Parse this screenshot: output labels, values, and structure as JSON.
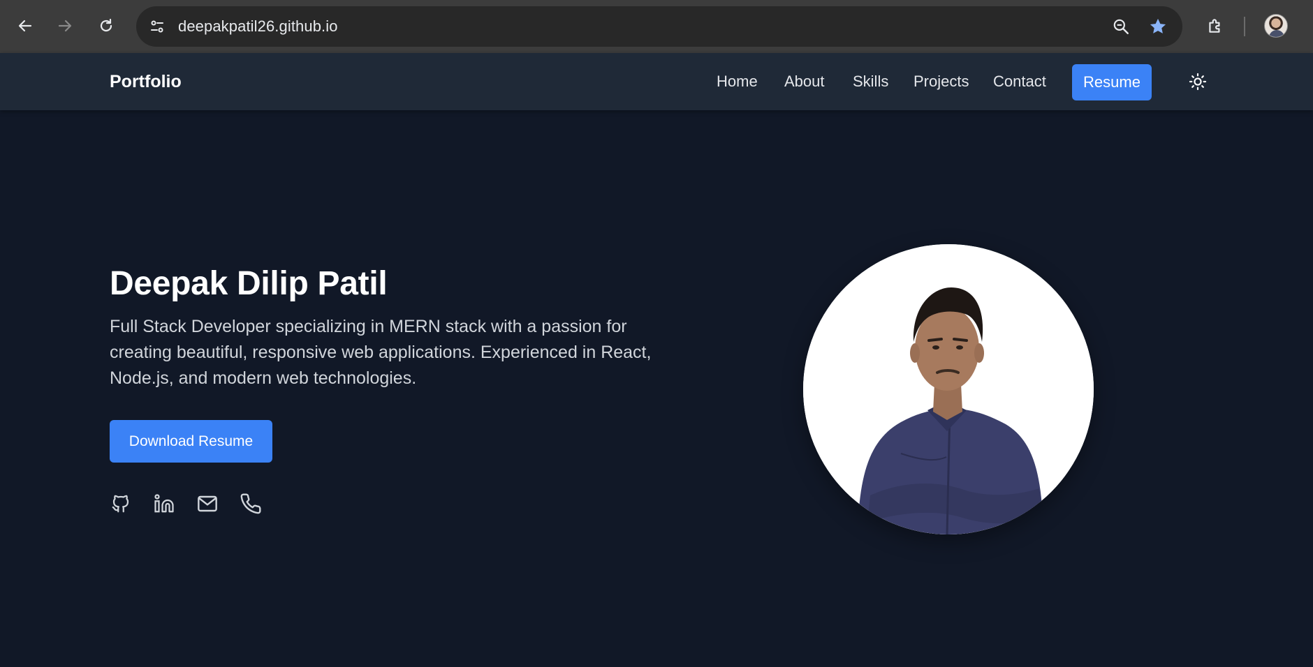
{
  "browser": {
    "url": "deepakpatil26.github.io",
    "icons": [
      "back-arrow-icon",
      "forward-arrow-icon",
      "reload-icon",
      "site-settings-icon",
      "zoom-icon",
      "bookmark-star-icon",
      "extensions-icon",
      "profile-avatar"
    ],
    "colors": {
      "bar": "#3c3c3c",
      "omnibox": "#282828",
      "star": "#8ab4f8"
    }
  },
  "nav": {
    "brand": "Portfolio",
    "links": [
      "Home",
      "About",
      "Skills",
      "Projects",
      "Contact"
    ],
    "resume_label": "Resume",
    "theme_icon": "sun-icon"
  },
  "hero": {
    "name": "Deepak Dilip Patil",
    "description": "Full Stack Developer specializing in MERN stack with a passion for creating beautiful, responsive web applications. Experienced in React, Node.js, and modern web technologies.",
    "download_label": "Download Resume",
    "social_icons": [
      "github-icon",
      "linkedin-icon",
      "mail-icon",
      "phone-icon"
    ]
  },
  "theme": {
    "page_bg": "#111827",
    "nav_bg": "#1f2937",
    "accent": "#3b82f6",
    "text": "#ffffff",
    "muted_text": "#d1d5db"
  }
}
